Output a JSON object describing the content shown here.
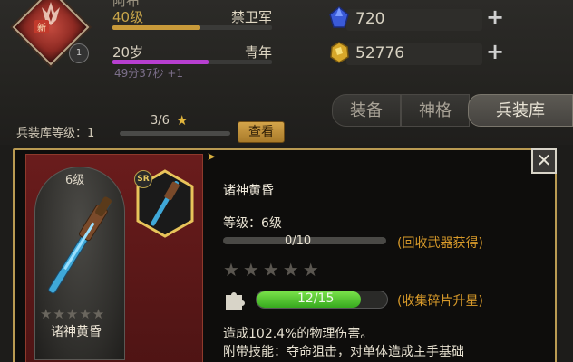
{
  "profile": {
    "new_tag": "新",
    "badge_number": "1",
    "name_partial": "阿布",
    "level_label": "40级",
    "title": "禁卫军",
    "level_progress": 0.55,
    "age_label": "20岁",
    "age_stage": "青年",
    "age_progress": 0.6,
    "timer_text": "49分37秒 +1"
  },
  "currencies": {
    "blue_gem": {
      "value": "720",
      "icon": "blue-crystal-icon",
      "plus": "+"
    },
    "gold_gem": {
      "value": "52776",
      "icon": "gold-ore-icon",
      "plus": "+"
    }
  },
  "tabs": [
    {
      "label": "装备",
      "active": false
    },
    {
      "label": "神格",
      "active": false
    },
    {
      "label": "兵装库",
      "active": true
    }
  ],
  "armory": {
    "level_label": "兵装库等级：1",
    "progress_text": "3/6",
    "star": "★",
    "view_button": "查看"
  },
  "weapon": {
    "card_level": "6级",
    "card_name": "诸神黄昏",
    "rarity": "SR",
    "card_stars": "★★★★★",
    "name": "诸神黄昏",
    "level_text": "等级：6级",
    "exp_text": "0/10",
    "exp_progress": 0.0,
    "recycle_link": "(回收武器获得)",
    "stars": "★★★★★",
    "fragments_text": "12/15",
    "fragments_progress": 0.8,
    "collect_link": "(收集碎片升星)",
    "desc_line1": "造成102.4%的物理伤害。",
    "desc_line2": "附带技能：夺命狙击，对单体造成主手基础"
  },
  "close_icon": "close-icon",
  "colors": {
    "accent_gold": "#c9a64a",
    "link_orange": "#d89a2a",
    "fragment_green": "#4ccc2a",
    "age_purple": "#b73fd0"
  }
}
